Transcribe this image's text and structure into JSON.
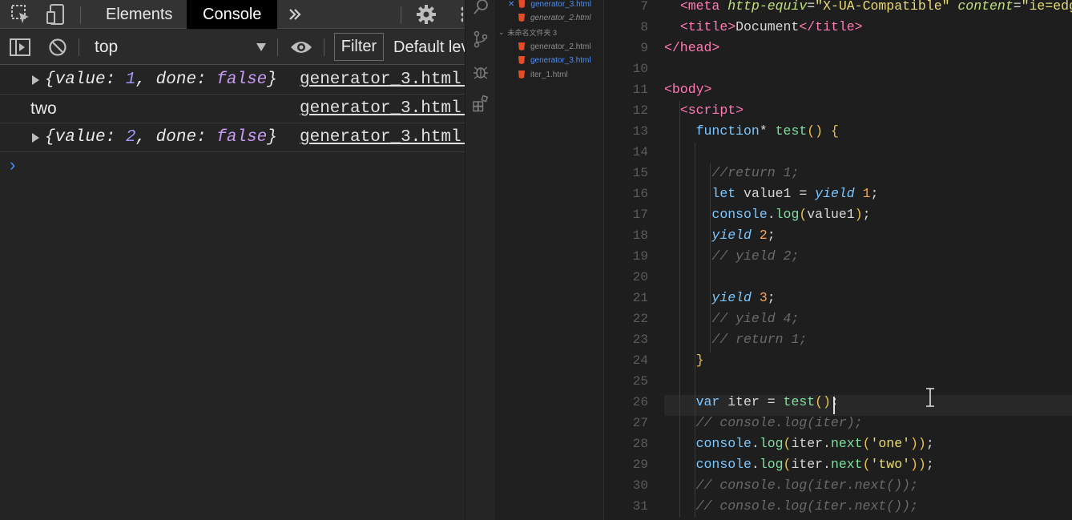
{
  "devtools": {
    "tabs": [
      {
        "label": "Elements",
        "active": false
      },
      {
        "label": "Console",
        "active": true
      }
    ],
    "toolbar": {
      "context": "top",
      "filter_label": "Filter",
      "levels_label": "Default lev"
    },
    "console": {
      "rows": [
        {
          "expandable": true,
          "pre": "{value: ",
          "num": "1",
          "mid": ", done: ",
          "bool": "false",
          "post": "}",
          "source": "generator_3.html:"
        },
        {
          "expandable": false,
          "text": "two",
          "source": "generator_3.html:"
        },
        {
          "expandable": true,
          "pre": "{value: ",
          "num": "2",
          "mid": ", done: ",
          "bool": "false",
          "post": "}",
          "source": "generator_3.html:"
        }
      ],
      "prompt": "›"
    }
  },
  "explorer": {
    "items": [
      {
        "label": "generator_3.html",
        "active": true,
        "indent": 1,
        "close": true
      },
      {
        "label": "generator_2.html",
        "active": false,
        "indent": 1,
        "close": false
      },
      {
        "label": "未命名文件夹 3",
        "active": false,
        "indent": 0,
        "folder": true
      },
      {
        "label": "generator_2.html",
        "active": false,
        "indent": 1
      },
      {
        "label": "generator_3.html",
        "active": true,
        "indent": 1
      },
      {
        "label": "iter_1.html",
        "active": false,
        "indent": 1
      }
    ]
  },
  "editor": {
    "line_numbers": [
      "7",
      "8",
      "9",
      "10",
      "11",
      "12",
      "13",
      "14",
      "15",
      "16",
      "17",
      "18",
      "19",
      "20",
      "21",
      "22",
      "23",
      "24",
      "25",
      "26",
      "27",
      "28",
      "29",
      "30",
      "31"
    ],
    "lines": [
      [
        [
          "",
          "  "
        ],
        [
          "tag",
          "<meta "
        ],
        [
          "attr",
          "http-equiv"
        ],
        [
          "txt",
          "="
        ],
        [
          "str",
          "\"X-UA-Compatible\""
        ],
        [
          "txt",
          " "
        ],
        [
          "attr",
          "content"
        ],
        [
          "txt",
          "="
        ],
        [
          "str",
          "\"ie=edge\""
        ]
      ],
      [
        [
          "",
          "  "
        ],
        [
          "tag",
          "<title>"
        ],
        [
          "txt",
          "Document"
        ],
        [
          "tag",
          "</title>"
        ]
      ],
      [
        [
          "tag",
          "</head>"
        ]
      ],
      [],
      [
        [
          "tag",
          "<body>"
        ]
      ],
      [
        [
          "",
          "  "
        ],
        [
          "tag",
          "<script>"
        ]
      ],
      [
        [
          "",
          "    "
        ],
        [
          "kw",
          "function"
        ],
        [
          "txt",
          "* "
        ],
        [
          "fn",
          "test"
        ],
        [
          "pun",
          "() {"
        ]
      ],
      [],
      [
        [
          "",
          "      "
        ],
        [
          "cmt",
          "//return 1;"
        ]
      ],
      [
        [
          "",
          "      "
        ],
        [
          "kw",
          "let"
        ],
        [
          "txt",
          " value1 = "
        ],
        [
          "yld",
          "yield"
        ],
        [
          "txt",
          " "
        ],
        [
          "n",
          "1"
        ],
        [
          "txt",
          ";"
        ]
      ],
      [
        [
          "",
          "      "
        ],
        [
          "kw",
          "console"
        ],
        [
          "txt",
          "."
        ],
        [
          "fn",
          "log"
        ],
        [
          "pun",
          "("
        ],
        [
          "txt",
          "value1"
        ],
        [
          "pun",
          ")"
        ],
        [
          "txt",
          ";"
        ]
      ],
      [
        [
          "",
          "      "
        ],
        [
          "yld",
          "yield"
        ],
        [
          "txt",
          " "
        ],
        [
          "n",
          "2"
        ],
        [
          "txt",
          ";"
        ]
      ],
      [
        [
          "",
          "      "
        ],
        [
          "cmt",
          "// yield 2;"
        ]
      ],
      [],
      [
        [
          "",
          "      "
        ],
        [
          "yld",
          "yield"
        ],
        [
          "txt",
          " "
        ],
        [
          "n",
          "3"
        ],
        [
          "txt",
          ";"
        ]
      ],
      [
        [
          "",
          "      "
        ],
        [
          "cmt",
          "// yield 4;"
        ]
      ],
      [
        [
          "",
          "      "
        ],
        [
          "cmt",
          "// return 1;"
        ]
      ],
      [
        [
          "",
          "    "
        ],
        [
          "pun",
          "}"
        ]
      ],
      [],
      [
        [
          "",
          "    "
        ],
        [
          "kw",
          "var"
        ],
        [
          "txt",
          " iter = "
        ],
        [
          "fn",
          "test"
        ],
        [
          "pun",
          "()"
        ],
        [
          "txt",
          ";"
        ]
      ],
      [
        [
          "",
          "    "
        ],
        [
          "cmt",
          "// console.log(iter);"
        ]
      ],
      [
        [
          "",
          "    "
        ],
        [
          "kw",
          "console"
        ],
        [
          "txt",
          "."
        ],
        [
          "fn",
          "log"
        ],
        [
          "pun",
          "("
        ],
        [
          "txt",
          "iter."
        ],
        [
          "fn",
          "next"
        ],
        [
          "pun",
          "("
        ],
        [
          "str",
          "'one'"
        ],
        [
          "pun",
          "))"
        ],
        [
          "txt",
          ";"
        ]
      ],
      [
        [
          "",
          "    "
        ],
        [
          "kw",
          "console"
        ],
        [
          "txt",
          "."
        ],
        [
          "fn",
          "log"
        ],
        [
          "pun",
          "("
        ],
        [
          "txt",
          "iter."
        ],
        [
          "fn",
          "next"
        ],
        [
          "pun",
          "("
        ],
        [
          "str",
          "'two'"
        ],
        [
          "pun",
          "))"
        ],
        [
          "txt",
          ";"
        ]
      ],
      [
        [
          "",
          "    "
        ],
        [
          "cmt",
          "// console.log(iter.next());"
        ]
      ],
      [
        [
          "",
          "    "
        ],
        [
          "cmt",
          "// console.log(iter.next());"
        ]
      ]
    ]
  },
  "colors": {
    "accent": "#4a8cff",
    "tag": "#ff7ab2",
    "string": "#e6db74",
    "keyword": "#7dc7ff",
    "function": "#7de0a0",
    "number": "#f5a55b",
    "comment": "#6a6a6a"
  },
  "icons": [
    "inspect-icon",
    "device-toggle-icon",
    "more-tabs-icon",
    "gear-icon",
    "kebab-icon",
    "sidebar-toggle-icon",
    "clear-console-icon",
    "eye-icon",
    "search-icon",
    "source-control-icon",
    "debug-icon",
    "extensions-icon",
    "html-file-icon",
    "close-icon",
    "text-cursor-icon"
  ]
}
